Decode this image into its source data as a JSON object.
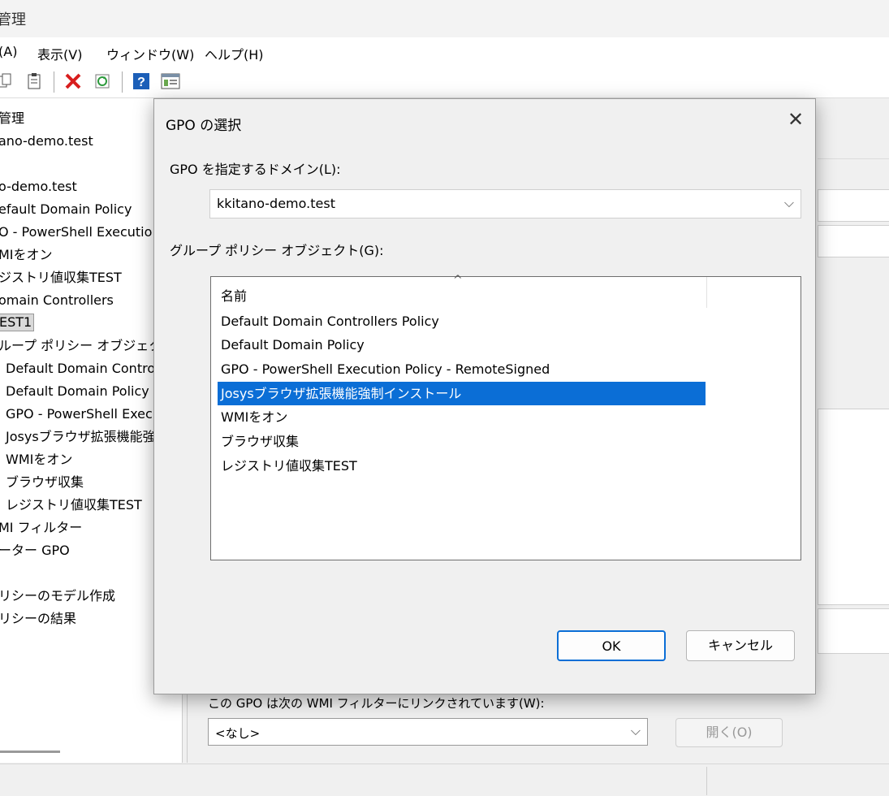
{
  "window": {
    "title": "管理"
  },
  "menu": [
    {
      "label": "(A)"
    },
    {
      "label": "表示(V)"
    },
    {
      "label": "ウィンドウ(W)"
    },
    {
      "label": "ヘルプ(H)"
    }
  ],
  "tree": {
    "items": [
      "管理",
      "ano-demo.test",
      "o-demo.test",
      "efault Domain Policy",
      "O - PowerShell Executio",
      "MIをオン",
      "ジストリ値収集TEST",
      "omain Controllers",
      "EST1",
      "ループ ポリシー オブジェクト",
      "Default Domain Contro",
      "Default Domain Policy",
      "GPO - PowerShell Exec",
      "Josysブラウザ拡張機能強",
      "WMIをオン",
      "ブラウザ収集",
      "レジストリ値収集TEST",
      "MI フィルター",
      "ーター GPO",
      "リシーのモデル作成",
      "リシーの結果"
    ]
  },
  "wmi": {
    "label": "この GPO は次の WMI フィルターにリンクされています(W):",
    "selected": "<なし>",
    "open_label": "開く(O)"
  },
  "dialog": {
    "title": "GPO の選択",
    "close_glyph": "✕",
    "domain_label": "GPO を指定するドメイン(L):",
    "domain_value": "kkitano-demo.test",
    "objects_label": "グループ ポリシー オブジェクト(G):",
    "list_header": "名前",
    "sort_glyph": "^",
    "gpos": [
      "Default Domain Controllers Policy",
      "Default Domain Policy",
      "GPO - PowerShell Execution Policy - RemoteSigned",
      "Josysブラウザ拡張機能強制インストール",
      "WMIをオン",
      "ブラウザ収集",
      "レジストリ値収集TEST"
    ],
    "selected_index": 3,
    "ok_label": "OK",
    "cancel_label": "キャンセル"
  },
  "icons": [
    "copy-icon",
    "paste-icon",
    "delete-icon",
    "refresh-icon",
    "help-icon",
    "console-icon"
  ],
  "colors": {
    "selection": "#0b6ed6",
    "delete": "#d81e1e",
    "help": "#1c5fb8"
  }
}
